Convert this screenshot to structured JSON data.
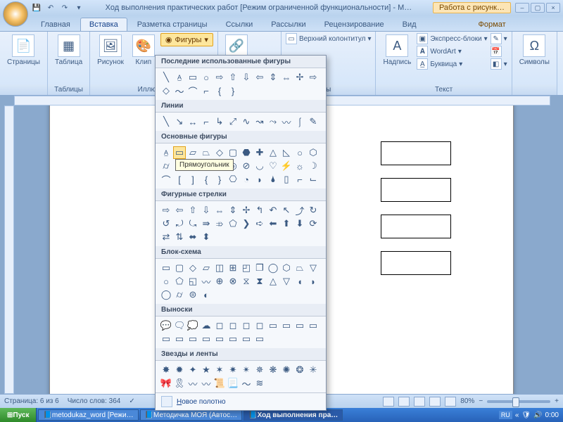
{
  "title": "Ход выполнения практических работ [Режим ограниченной функциональности] - M…",
  "tool_context": "Работа с рисунк…",
  "tabs": {
    "home": "Главная",
    "insert": "Вставка",
    "layout": "Разметка страницы",
    "refs": "Ссылки",
    "mail": "Рассылки",
    "review": "Рецензирование",
    "view": "Вид",
    "format": "Формат"
  },
  "groups": {
    "pages": "Страницы",
    "tables": "Таблицы",
    "illust": "Иллюст…",
    "header_footer": "ы",
    "text": "Текст",
    "symbols": "Символы"
  },
  "btns": {
    "table": "Таблица",
    "picture": "Рисунок",
    "clip": "Клип",
    "shapes": "Фигуры",
    "header": "Верхний колонтитул",
    "textbox": "Надпись",
    "quickparts": "Экспресс-блоки",
    "wordart": "WordArt",
    "dropcap": "Буквица"
  },
  "dd": {
    "recent": "Последние использованные фигуры",
    "lines": "Линии",
    "basic": "Основные фигуры",
    "arrows": "Фигурные стрелки",
    "flowchart": "Блок-схема",
    "callouts": "Выноски",
    "stars": "Звезды и ленты",
    "newcanvas": "Новое полотно",
    "tooltip_rect": "Прямоугольник"
  },
  "status": {
    "page": "Страница: 6 из 6",
    "words": "Число слов: 364",
    "zoom": "80%"
  },
  "taskbar": {
    "start": "Пуск",
    "t1": "metodukaz_word [Режи…",
    "t2": "Методичка МОЯ (Автос…",
    "t3": "Ход выполнения пра…",
    "lang": "RU",
    "time": "0:00"
  }
}
